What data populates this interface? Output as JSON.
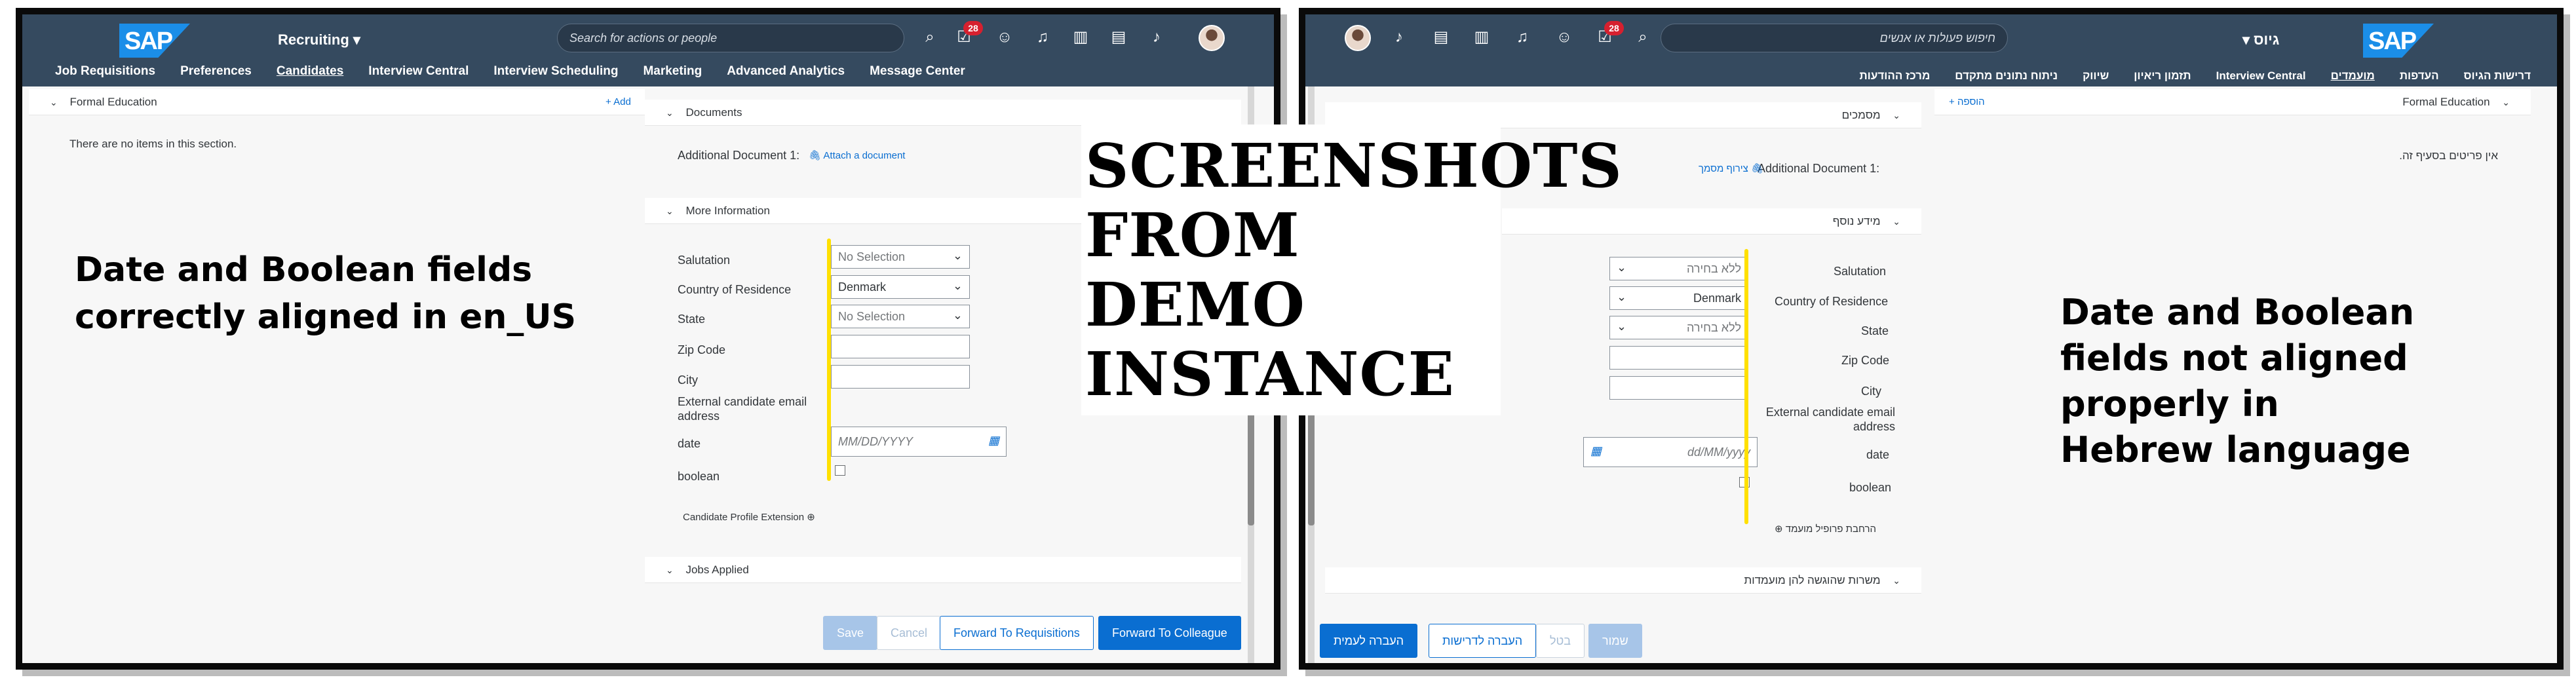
{
  "banner": "SCREENSHOTS\nFROM DEMO\nINSTANCE",
  "left": {
    "annotation": "Date and Boolean fields\ncorrectly aligned in en_US",
    "shell": {
      "logo": "SAP",
      "module": "Recruiting ▾",
      "search_placeholder": "Search for actions or people",
      "badge": "28",
      "icons": [
        "search-icon",
        "todo-icon",
        "people-icon",
        "headset-icon",
        "book-icon",
        "guide-icon",
        "bell-icon"
      ]
    },
    "tabs": [
      "Job Requisitions",
      "Preferences",
      "Candidates",
      "Interview Central",
      "Interview Scheduling",
      "Marketing",
      "Advanced Analytics",
      "Message Center"
    ],
    "formal_education": {
      "title": "Formal Education",
      "add": "+ Add",
      "empty": "There are no items in this section."
    },
    "documents": {
      "title": "Documents",
      "label": "Additional Document 1:",
      "link": "Attach a document"
    },
    "more_info": {
      "title": "More Information",
      "salutation": {
        "label": "Salutation",
        "value": "No Selection"
      },
      "country": {
        "label": "Country of Residence",
        "value": "Denmark"
      },
      "state": {
        "label": "State",
        "value": "No Selection"
      },
      "zip": {
        "label": "Zip Code"
      },
      "city": {
        "label": "City"
      },
      "email": {
        "label": "External candidate email\naddress"
      },
      "date": {
        "label": "date",
        "placeholder": "MM/DD/YYYY"
      },
      "boolean": {
        "label": "boolean"
      },
      "extension": "Candidate Profile Extension"
    },
    "jobs_applied": "Jobs Applied",
    "buttons": {
      "save": "Save",
      "cancel": "Cancel",
      "forward_req": "Forward To Requisitions",
      "forward_colleague": "Forward To Colleague"
    }
  },
  "right": {
    "annotation": "Date and Boolean\nfields not aligned\nproperly in\nHebrew language",
    "shell": {
      "logo": "SAP",
      "module": "▾ גיוס",
      "search_placeholder": "חיפוש פעולות או אנשים",
      "badge": "28"
    },
    "tabs": [
      "דרישות הגיוס",
      "העדפות",
      "מועמדים",
      "Interview Central",
      "תזמון ריאיון",
      "שיווק",
      "ניתוח נתונים מתקדם",
      "מרכז ההודעות"
    ],
    "formal_education": {
      "title": "Formal Education",
      "add": "+ הוספה",
      "empty": "אין פריטים בסעיף זה."
    },
    "documents": {
      "title": "מסמכים",
      "label": "Additional Document 1:",
      "link": "צירוף מסמך"
    },
    "more_info": {
      "title": "מידע נוסף",
      "salutation": {
        "label": "Salutation",
        "value": "ללא בחירה"
      },
      "country": {
        "label": "Country of Residence",
        "value": "Denmark"
      },
      "state": {
        "label": "State",
        "value": "ללא בחירה"
      },
      "zip": {
        "label": "Zip Code"
      },
      "city": {
        "label": "City"
      },
      "email": {
        "label": "External candidate email\naddress"
      },
      "date": {
        "label": "date",
        "placeholder": "dd/MM/yyyy"
      },
      "boolean": {
        "label": "boolean"
      },
      "extension": "הרחבת פרופיל מועמד"
    },
    "jobs_applied": "משרות שהוגשה להן מועמדות",
    "buttons": {
      "save": "שמור",
      "cancel": "בטל",
      "forward_req": "העברה לדרישות",
      "forward_colleague": "העברה לעמית"
    }
  },
  "colors": {
    "shell": "#354a5f",
    "accent": "#0a6ed1",
    "highlight": "#ffe000"
  }
}
